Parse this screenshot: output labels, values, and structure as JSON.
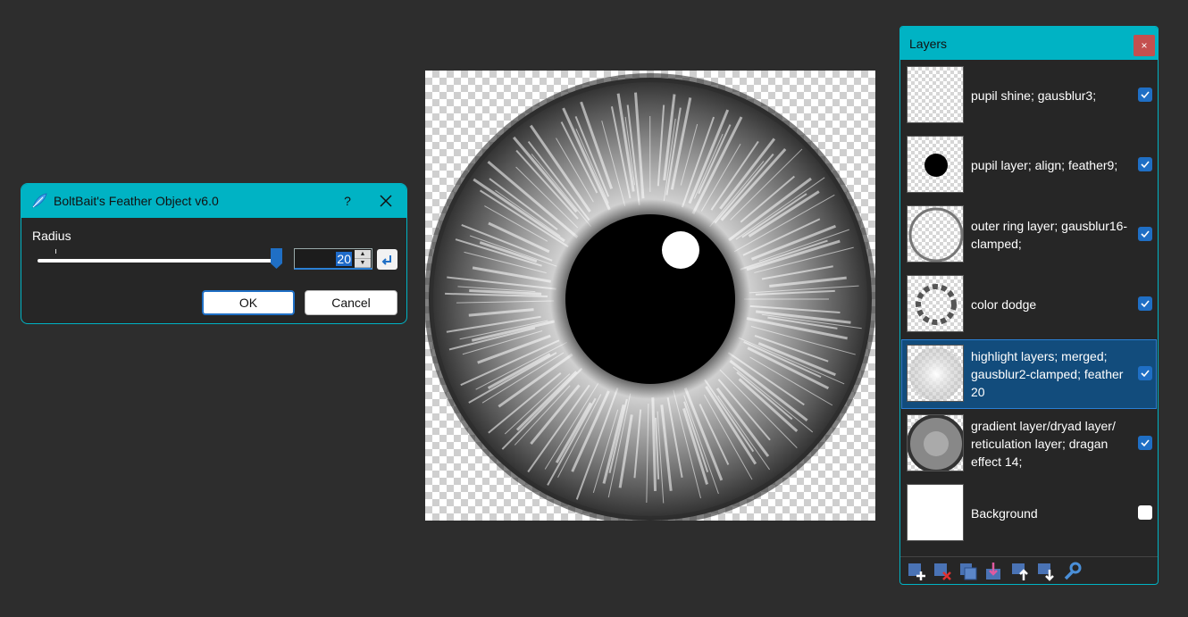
{
  "dialog": {
    "title": "BoltBait's Feather Object v6.0",
    "help": "?",
    "radius_label": "Radius",
    "radius_value": "20",
    "ok_label": "OK",
    "cancel_label": "Cancel"
  },
  "layers_panel": {
    "title": "Layers",
    "close": "×",
    "items": [
      {
        "name": "pupil shine; gausblur3;",
        "visible": true
      },
      {
        "name": "pupil layer; align; feather9;",
        "visible": true
      },
      {
        "name": "outer ring layer; gausblur16-clamped;",
        "visible": true
      },
      {
        "name": "color dodge",
        "visible": true
      },
      {
        "name": "highlight layers; merged; gausblur2-clamped; feather 20",
        "visible": true,
        "selected": true
      },
      {
        "name": "gradient layer/dryad layer/ reticulation layer; dragan effect 14;",
        "visible": true
      },
      {
        "name": "Background",
        "visible": false
      }
    ],
    "toolbar": [
      "add-layer-icon",
      "delete-layer-icon",
      "duplicate-layer-icon",
      "merge-layer-down-icon",
      "move-layer-up-icon",
      "move-layer-down-icon",
      "layer-properties-icon"
    ]
  },
  "colors": {
    "accent": "#00b3c4",
    "selection": "#124c7c",
    "checkbox": "#1f6fc5"
  }
}
